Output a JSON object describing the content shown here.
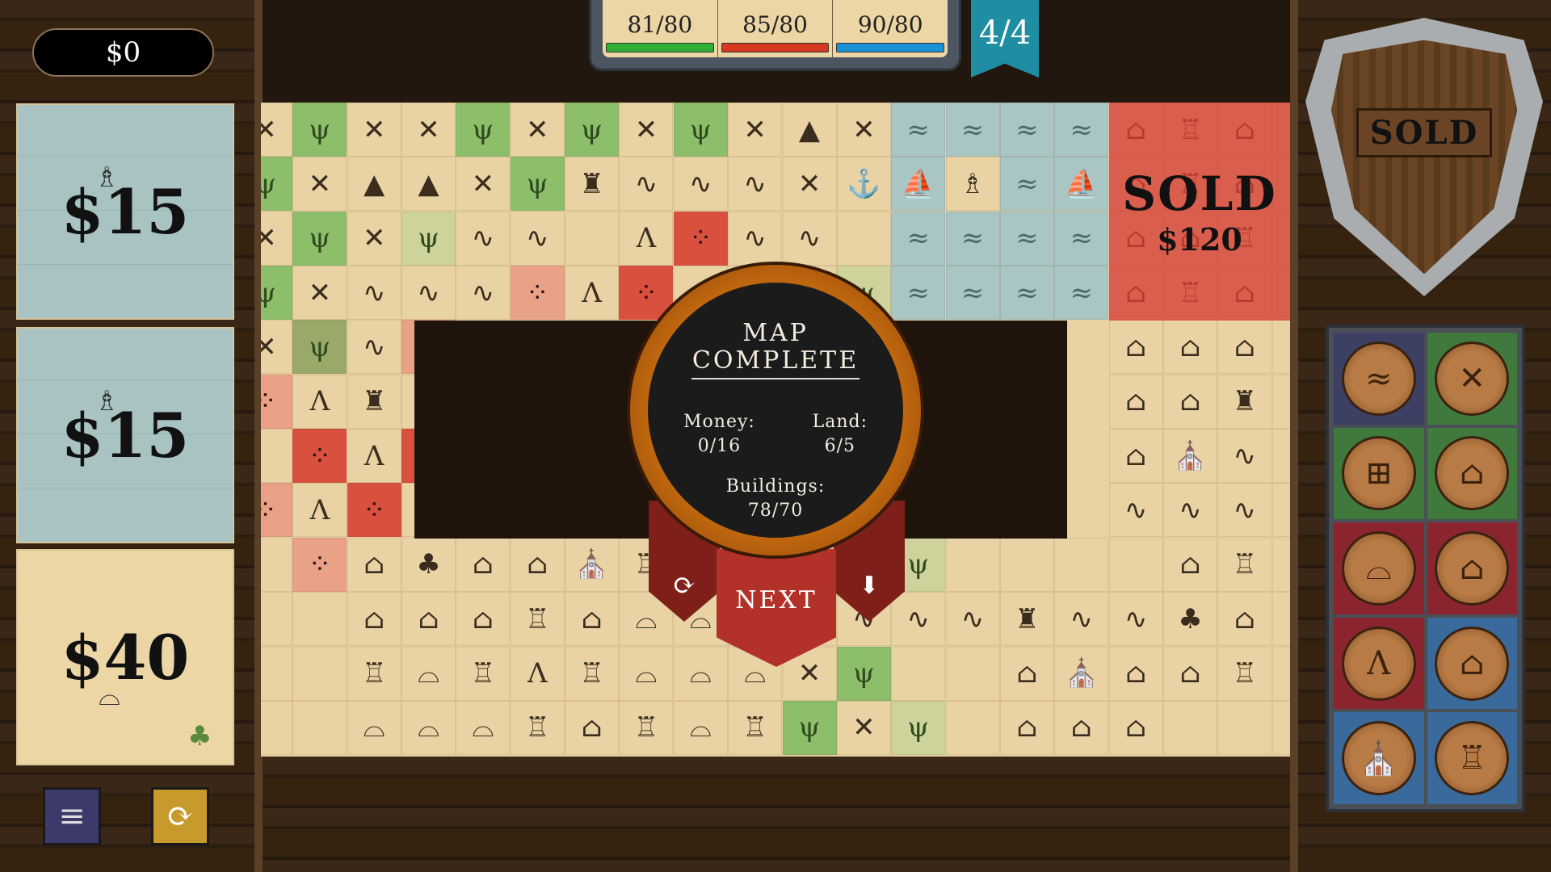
{
  "hud": {
    "money": "$0"
  },
  "cards": [
    {
      "price": "$15",
      "type": "water",
      "icon": "lighthouse-icon",
      "glyph": "♗"
    },
    {
      "price": "$15",
      "type": "water",
      "icon": "lighthouse-icon",
      "glyph": "♗"
    },
    {
      "price": "$40",
      "type": "land",
      "icon": "mine-icon",
      "glyph": "⌓",
      "icon2": "trees-icon",
      "glyph2": "♣"
    }
  ],
  "buttons": {
    "stack": "≡",
    "refresh": "⟳"
  },
  "score": [
    {
      "label": "81/80",
      "color": "#2fae35"
    },
    {
      "label": "85/80",
      "color": "#d53a20"
    },
    {
      "label": "90/80",
      "color": "#1a93d6"
    }
  ],
  "round": "4/4",
  "sold_region": {
    "label": "SOLD",
    "price": "$120"
  },
  "shield": {
    "label": "SOLD"
  },
  "medal": {
    "title1": "MAP",
    "title2": "COMPLETE",
    "money_label": "Money:",
    "money": "0/16",
    "land_label": "Land:",
    "land": "6/5",
    "buildings_label": "Buildings:",
    "buildings": "78/70",
    "next": "NEXT",
    "retry_icon": "⟳",
    "download_icon": "⬇"
  },
  "colors": {
    "p": "#e9d3a4",
    "g": "#8dbf6a",
    "l": "#cdd39b",
    "w": "#a9c5c4",
    "r": "#d9503f",
    "s": "#e9a286",
    "d": "#9aa86a"
  },
  "glyphs": {
    "windmill": "✕",
    "grass": "ψ",
    "mountain": "▲",
    "castle": "♜",
    "road": "∿",
    "dock": "⚓",
    "ship": "⛵",
    "lighthouse": "♗",
    "tent": "Λ",
    "paw": "⁘",
    "house": "⌂",
    "church": "⛪",
    "tower": "♖",
    "hut": "⌂",
    "mine": "⌓",
    "trees": "♣",
    "swamp": "ψ",
    "": ""
  },
  "board": {
    "rows": [
      "p:windmill g:grass p:windmill p:windmill g:grass p:windmill g:grass p:windmill g:grass p:windmill p:mountain p:windmill w: w: w: w: p:house p:tower p:house p:",
      "g:grass p:windmill p:mountain p:mountain p:windmill g:grass p:castle p:road p:road p:road p:windmill p:dock w:ship p:lighthouse w: w:ship p:house p:tower p:house p:",
      "p:windmill g:grass p:windmill l:grass p:road p:road p: p:tent r:paw p:road p:road p: w: w: w: w: p:house p:house p:tower p:",
      "g:grass p:windmill p:road p:road p:road s:paw p:tent r:paw p: p: p: l:grass w: w: w: w: p:house p:tower p:house p:",
      "p:windmill d:swamp p:road s:paw x x x x x x x x x x x x p:house p:house p:house p:",
      "s:paw p:tent p:castle p:tent x x x x x x x x x x x x p:house p:house p:castle p:",
      "p: r:paw p:tent r:paw x x x x x x x x x x x x p:house p:church p:road p:",
      "s:paw p:tent r:paw p:tent x x x x x x x x x x x x p:road p:road p:road p:",
      "p: s:paw p:hut p:trees p:hut p:house p:church p:tower p: p: p: p: l:grass p: p: p: p: p:hut p:tower p:",
      "p: p: p:house p:hut p:house p:tower p:house p:mine p:mine p: p:road p:road p:road p:road p:castle p:road p:road p:trees p:hut p:",
      "p: p: p:tower p:mine p:tower p:tent p:tower p:mine p:mine p:mine p:windmill g:grass p: p: p:house p:church p:house p:hut p:tower p:",
      "p: p: p:mine p:mine p:mine p:tower p:house p:tower p:mine p:tower g:grass p:windmill l:grass p: p:house p:house p:house p: p: p:"
    ]
  },
  "filters": [
    {
      "color": "#3d3f63",
      "icon": "water-icon",
      "glyph": "≈"
    },
    {
      "color": "#3f7a3c",
      "icon": "windmill-icon",
      "glyph": "✕"
    },
    {
      "color": "#3f7a3c",
      "icon": "fence-icon",
      "glyph": "⊞"
    },
    {
      "color": "#3f7a3c",
      "icon": "farm-icon",
      "glyph": "⌂"
    },
    {
      "color": "#8a2530",
      "icon": "mine-icon",
      "glyph": "⌓"
    },
    {
      "color": "#8a2530",
      "icon": "hut-icon",
      "glyph": "⌂"
    },
    {
      "color": "#8a2530",
      "icon": "tent-icon",
      "glyph": "Λ"
    },
    {
      "color": "#3a6a9c",
      "icon": "house-icon",
      "glyph": "⌂"
    },
    {
      "color": "#3a6a9c",
      "icon": "church-icon",
      "glyph": "⛪"
    },
    {
      "color": "#3a6a9c",
      "icon": "tower-icon",
      "glyph": "♖"
    }
  ]
}
